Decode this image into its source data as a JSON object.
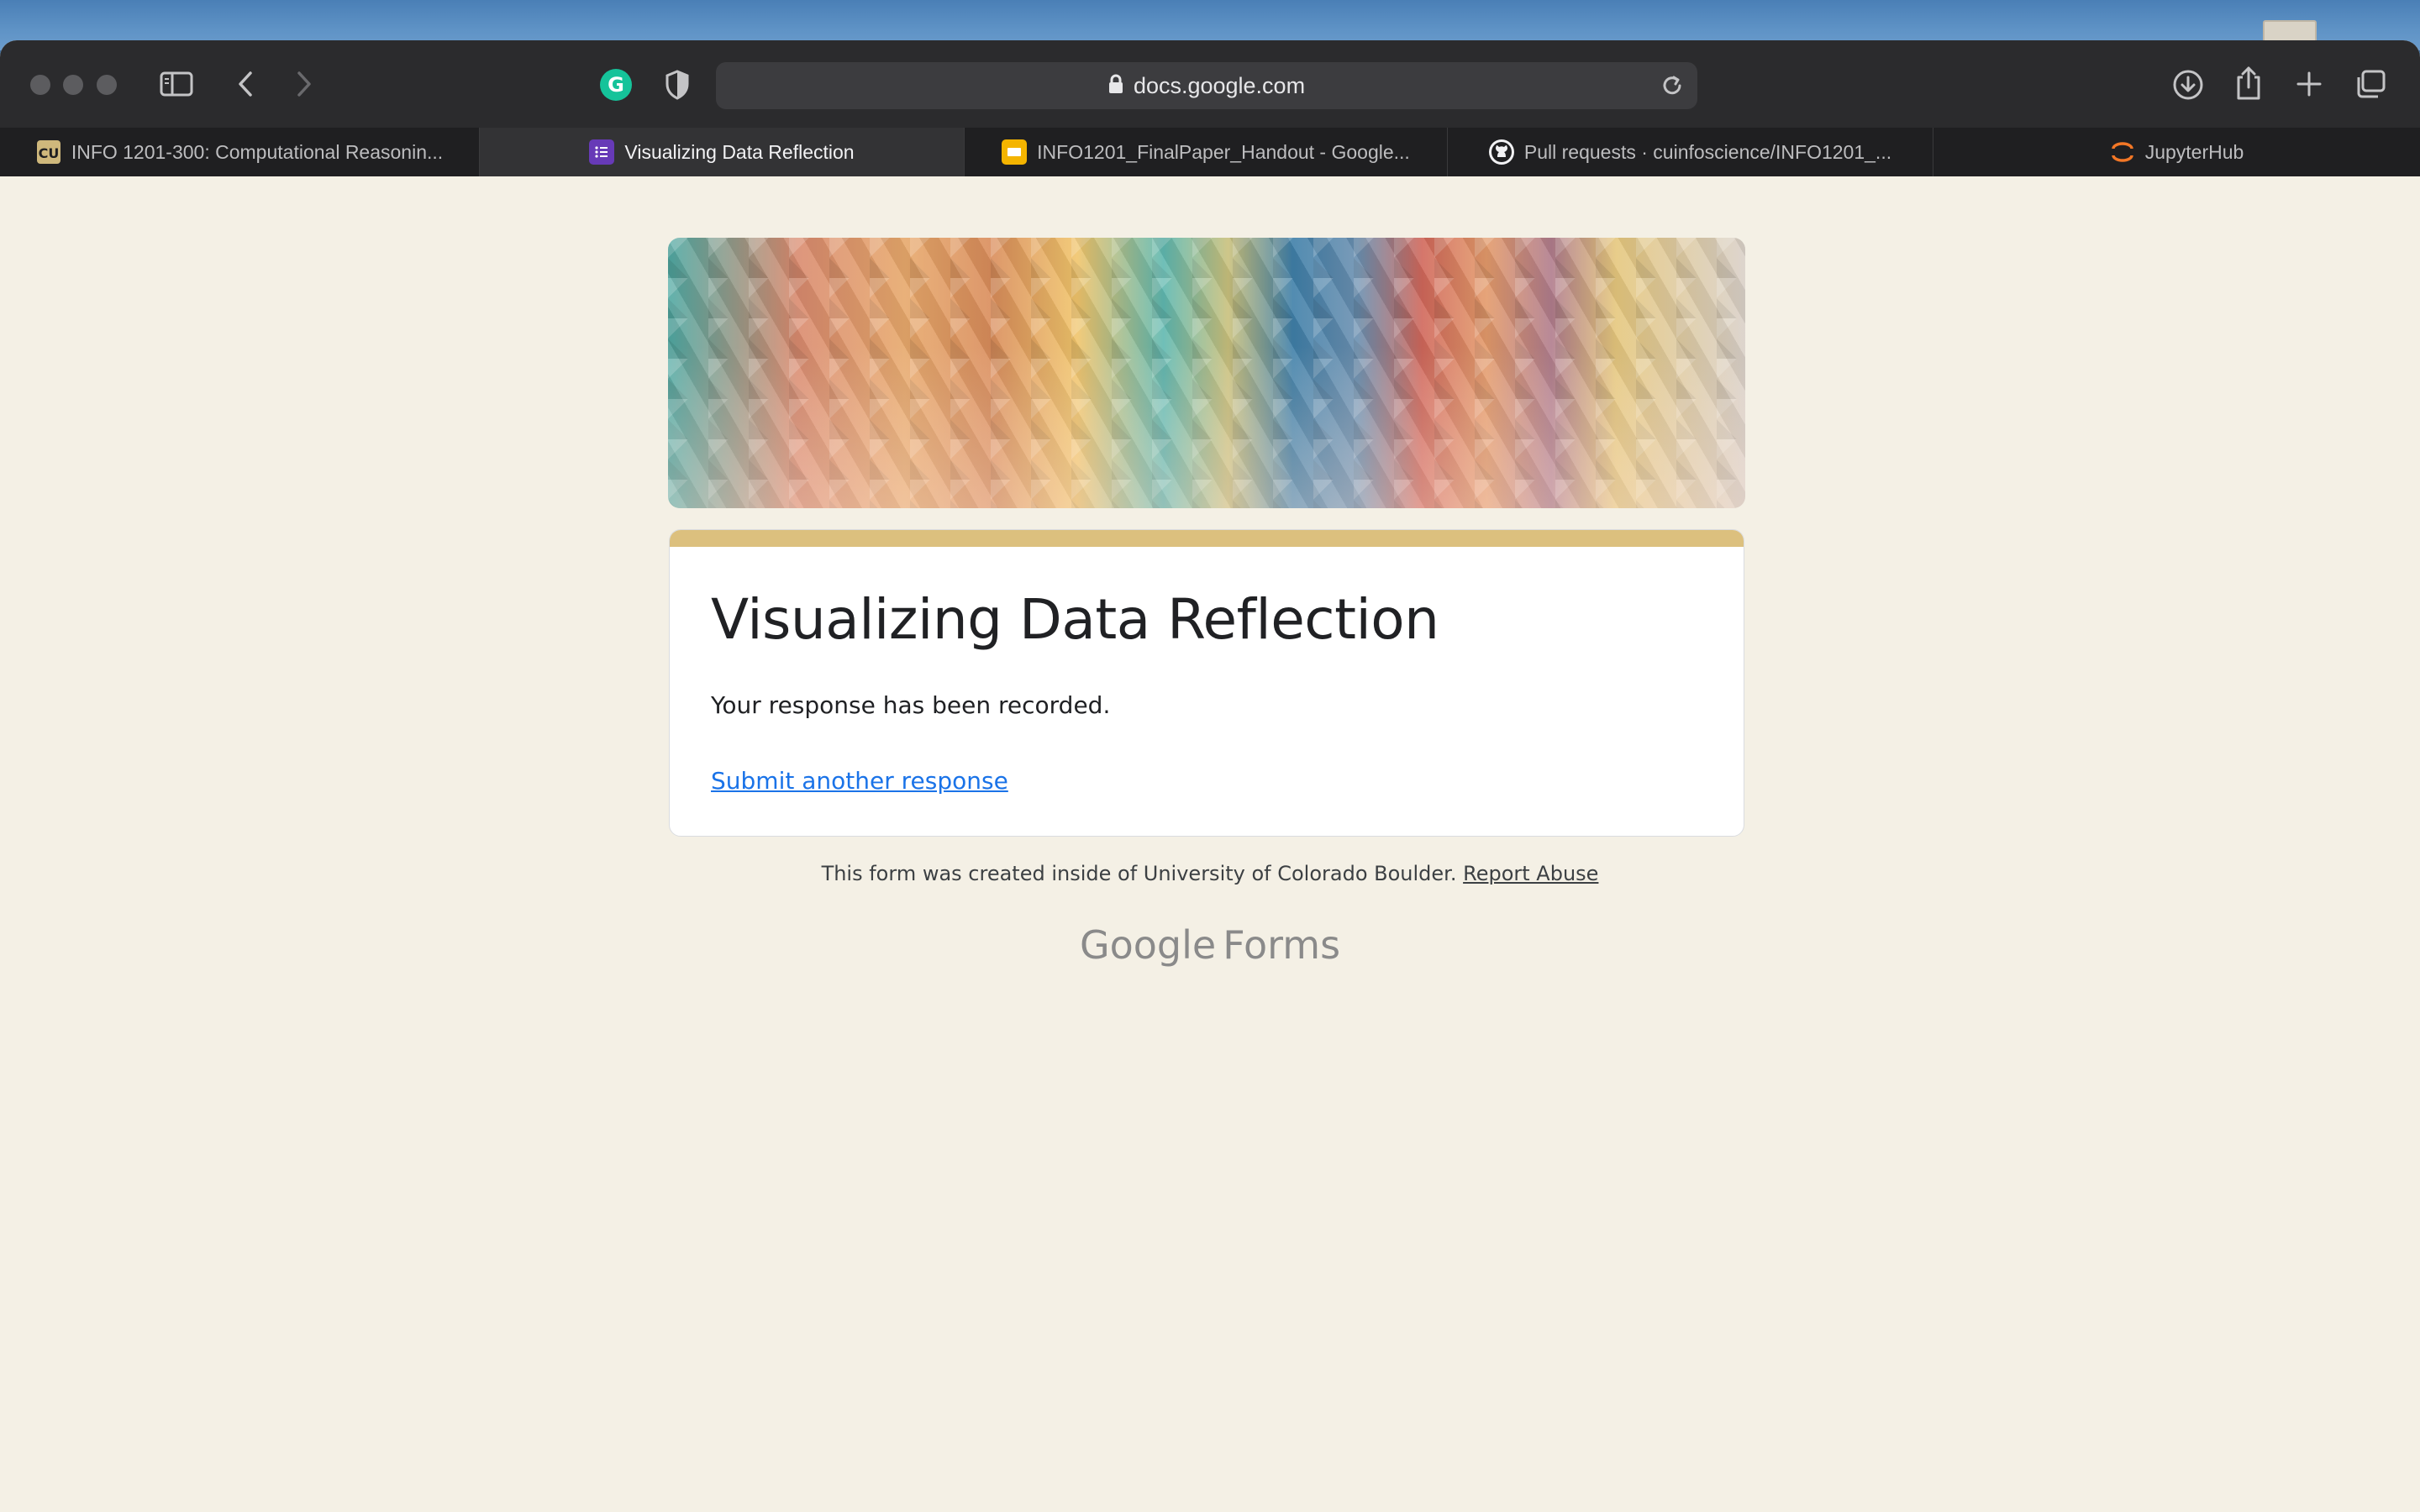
{
  "browser": {
    "address": "docs.google.com"
  },
  "tabs": [
    {
      "label": "INFO 1201-300: Computational Reasonin...",
      "icon": "cu-boulder-icon",
      "active": false
    },
    {
      "label": "Visualizing Data Reflection",
      "icon": "google-forms-icon",
      "active": true
    },
    {
      "label": "INFO1201_FinalPaper_Handout - Google...",
      "icon": "google-slides-icon",
      "active": false
    },
    {
      "label": "Pull requests · cuinfoscience/INFO1201_...",
      "icon": "github-icon",
      "active": false
    },
    {
      "label": "JupyterHub",
      "icon": "jupyter-icon",
      "active": false
    }
  ],
  "form": {
    "title": "Visualizing Data Reflection",
    "confirmation": "Your response has been recorded.",
    "submit_another": "Submit another response"
  },
  "footer": {
    "notice": "This form was created inside of University of Colorado Boulder.",
    "report_abuse": "Report Abuse",
    "brand_google": "Google",
    "brand_forms": "Forms"
  },
  "colors": {
    "accent_bar": "#dcc07e",
    "page_background": "#f4f0e5",
    "link": "#1a73e8"
  }
}
